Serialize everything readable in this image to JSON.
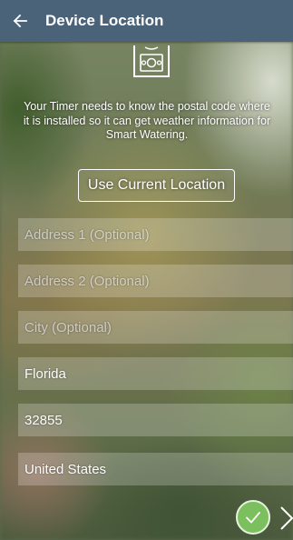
{
  "header": {
    "title": "Device Location",
    "back_icon": "arrow-left-icon",
    "color": "#4b6379"
  },
  "device_icon": "timer-device-icon",
  "info_text": "Your Timer needs to know the postal code where it is installed so it can get weather information for Smart Watering.",
  "use_location_button": "Use Current Location",
  "fields": {
    "address1": {
      "value": "",
      "placeholder": "Address 1 (Optional)"
    },
    "address2": {
      "value": "",
      "placeholder": "Address 2 (Optional)"
    },
    "city": {
      "value": "",
      "placeholder": "City (Optional)"
    },
    "state": {
      "value": "Florida",
      "placeholder": ""
    },
    "postal_code": {
      "value": "32855",
      "placeholder": ""
    },
    "country": {
      "value": "United States",
      "placeholder": ""
    }
  },
  "footer": {
    "confirm_icon": "checkmark-circle-icon",
    "confirm_color": "#7bbf5e",
    "next_icon": "chevron-right-icon"
  }
}
